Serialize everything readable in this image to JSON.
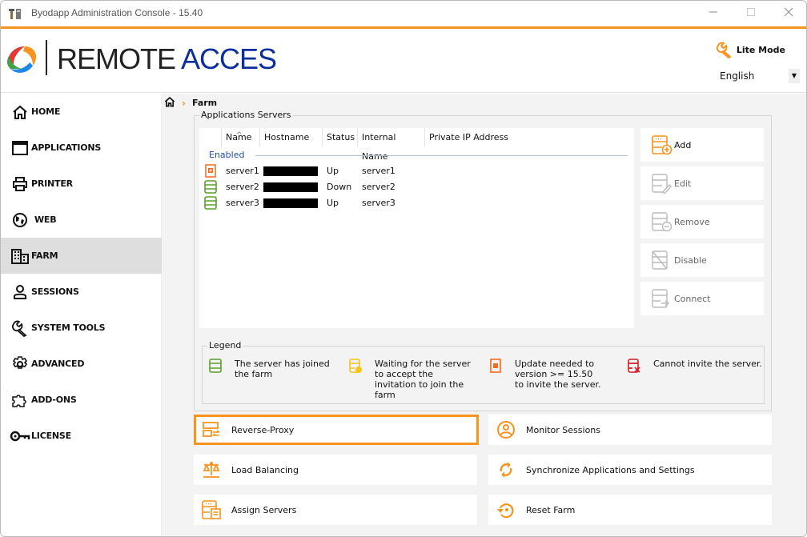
{
  "window": {
    "title": "Byodapp Administration Console - 15.40",
    "controls": [
      "minimize",
      "maximize",
      "close"
    ]
  },
  "header": {
    "logo_part1": "REMOTE",
    "logo_part2": "ACCES",
    "lite_mode_label": "Lite Mode",
    "language": "English"
  },
  "colors": {
    "accent": "#f7931e",
    "logo_blue": "#0d2f9c",
    "status_green": "#5aa02c",
    "status_yellow": "#f5c518",
    "status_orange": "#f26b1d",
    "status_red": "#d0202a"
  },
  "sidebar": {
    "items": [
      {
        "label": "HOME",
        "icon": "home-icon"
      },
      {
        "label": "APPLICATIONS",
        "icon": "window-icon"
      },
      {
        "label": "PRINTER",
        "icon": "printer-icon"
      },
      {
        "label": "WEB",
        "icon": "globe-icon"
      },
      {
        "label": "FARM",
        "icon": "building-icon",
        "active": true
      },
      {
        "label": "SESSIONS",
        "icon": "user-icon"
      },
      {
        "label": "SYSTEM TOOLS",
        "icon": "wrench-icon"
      },
      {
        "label": "ADVANCED",
        "icon": "gear-icon"
      },
      {
        "label": "ADD-ONS",
        "icon": "puzzle-icon"
      },
      {
        "label": "LICENSE",
        "icon": "key-icon"
      }
    ]
  },
  "breadcrumb": {
    "current": "Farm"
  },
  "servers": {
    "group_title": "Applications Servers",
    "columns": [
      "Name",
      "Hostname",
      "Status",
      "Internal Name",
      "Private IP Address"
    ],
    "group_label": "Enabled",
    "rows": [
      {
        "icon": "update-needed",
        "name": "server1",
        "hostname": "[redacted]",
        "status": "Up",
        "internal_name": "server1",
        "private_ip": ""
      },
      {
        "icon": "joined",
        "name": "server2",
        "hostname": "[redacted]",
        "status": "Down",
        "internal_name": "server2",
        "private_ip": ""
      },
      {
        "icon": "joined",
        "name": "server3",
        "hostname": "[redacted]",
        "status": "Up",
        "internal_name": "server3",
        "private_ip": ""
      }
    ]
  },
  "server_actions": {
    "add": "Add",
    "edit": "Edit",
    "remove": "Remove",
    "disable": "Disable",
    "connect": "Connect"
  },
  "legend": {
    "title": "Legend",
    "items": [
      {
        "icon": "joined",
        "text": "The server has joined the farm"
      },
      {
        "icon": "waiting",
        "text": "Waiting for the server to accept the invitation to join the farm"
      },
      {
        "icon": "update-needed",
        "text": "Update needed to version >= 15.50 to invite the server."
      },
      {
        "icon": "cannot-invite",
        "text": "Cannot invite the server."
      }
    ]
  },
  "actions": {
    "reverse_proxy": "Reverse-Proxy",
    "monitor_sessions": "Monitor Sessions",
    "load_balancing": "Load Balancing",
    "synchronize": "Synchronize Applications and Settings",
    "assign_servers": "Assign Servers",
    "reset_farm": "Reset Farm"
  }
}
